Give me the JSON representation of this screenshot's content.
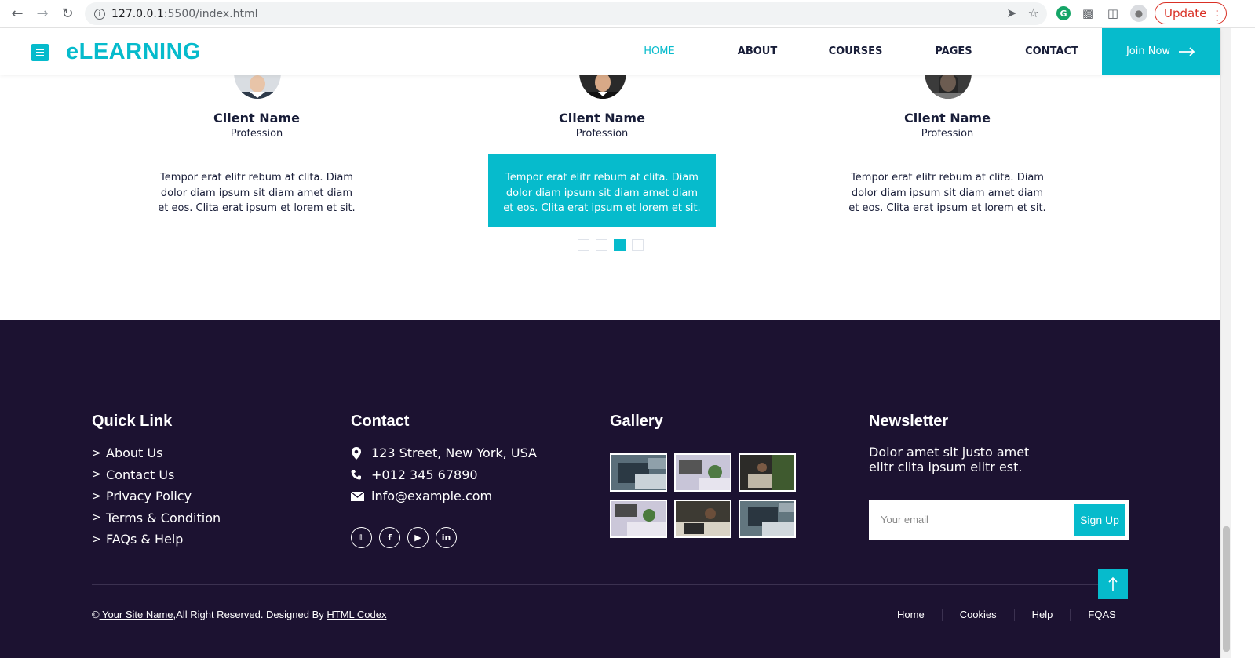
{
  "browser": {
    "url_host": "127.0.0.1",
    "url_path": ":5500/index.html",
    "update_label": "Update"
  },
  "header": {
    "brand": "eLEARNING",
    "nav": [
      "HOME",
      "ABOUT",
      "COURSES",
      "PAGES",
      "CONTACT"
    ],
    "active_nav": "HOME",
    "join_label": "Join Now"
  },
  "testimonials": [
    {
      "name": "Client Name",
      "profession": "Profession",
      "quote": "Tempor erat elitr rebum at clita. Diam dolor diam ipsum sit diam amet diam et eos. Clita erat ipsum et lorem et sit."
    },
    {
      "name": "Client Name",
      "profession": "Profession",
      "quote": "Tempor erat elitr rebum at clita. Diam dolor diam ipsum sit diam amet diam et eos. Clita erat ipsum et lorem et sit."
    },
    {
      "name": "Client Name",
      "profession": "Profession",
      "quote": "Tempor erat elitr rebum at clita. Diam dolor diam ipsum sit diam amet diam et eos. Clita erat ipsum et lorem et sit."
    }
  ],
  "carousel": {
    "dot_count": 4,
    "active_index": 2
  },
  "footer": {
    "quick_link": {
      "title": "Quick Link",
      "items": [
        "About Us",
        "Contact Us",
        "Privacy Policy",
        "Terms & Condition",
        "FAQs & Help"
      ]
    },
    "contact": {
      "title": "Contact",
      "address": "123 Street, New York, USA",
      "phone": "+012 345 67890",
      "email": "info@example.com",
      "socials": [
        "twitter-icon",
        "facebook-icon",
        "youtube-icon",
        "linkedin-icon"
      ]
    },
    "gallery": {
      "title": "Gallery"
    },
    "newsletter": {
      "title": "Newsletter",
      "text": "Dolor amet sit justo amet elitr clita ipsum elitr est.",
      "placeholder": "Your email",
      "button": "Sign Up"
    },
    "copyright": {
      "symbol": "©",
      "site_name": " Your Site Name",
      "reserved": ",All Right Reserved. Designed By ",
      "designer": "HTML Codex"
    },
    "menu": [
      "Home",
      "Cookies",
      "Help",
      "FQAS"
    ]
  },
  "colors": {
    "accent": "#06bbcc",
    "dark": "#181d38",
    "footer_bg": "#1c1231"
  }
}
